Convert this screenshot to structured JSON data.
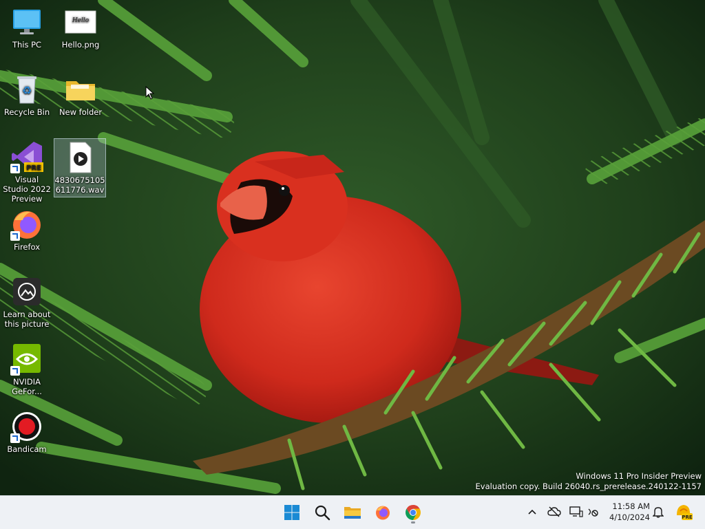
{
  "desktop": {
    "icons": [
      {
        "label": "This PC",
        "icon": "monitor-icon"
      },
      {
        "label": "Hello.png",
        "icon": "image-file-icon"
      },
      {
        "label": "Recycle Bin",
        "icon": "recycle-bin-icon"
      },
      {
        "label": "New folder",
        "icon": "folder-icon"
      },
      {
        "label": "Visual Studio 2022 Preview",
        "icon": "visual-studio-icon",
        "badge": "PRE"
      },
      {
        "label": "4830675105611776.wav",
        "icon": "audio-file-icon"
      },
      {
        "label": "Firefox",
        "icon": "firefox-icon"
      },
      {
        "label": "Learn about this picture",
        "icon": "learn-picture-icon"
      },
      {
        "label": "NVIDIA GeFor...",
        "icon": "nvidia-icon"
      },
      {
        "label": "Bandicam",
        "icon": "bandicam-icon"
      }
    ],
    "image_thumb_text": "Hello"
  },
  "watermark": {
    "line1": "Windows 11 Pro Insider Preview",
    "line2": "Evaluation copy. Build 26040.rs_prerelease.240122-1157"
  },
  "taskbar": {
    "pinned": [
      "start-button",
      "search-button",
      "file-explorer",
      "firefox",
      "chrome"
    ],
    "clock": {
      "time": "11:58 AM",
      "date": "4/10/2024"
    },
    "copilot_badge": "PRE"
  },
  "colors": {
    "taskbar_bg": "#eef1f5",
    "start_blue": "#1a8ad4",
    "cardinal_red": "#d42a1f"
  }
}
